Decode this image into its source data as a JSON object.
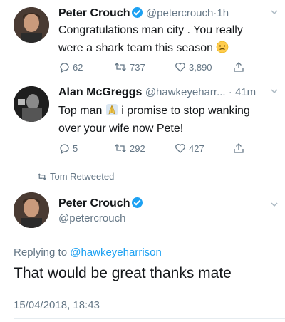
{
  "tweet1": {
    "name": "Peter Crouch",
    "handle": "@petercrouch",
    "time": "1h",
    "text_line1": "Congratulations man city . You really",
    "text_line2": "were a shark team this season",
    "emoji": "confused-face-emoji",
    "replies": "62",
    "retweets": "737",
    "likes": "3,890"
  },
  "tweet2": {
    "name": "Alan McGreggs",
    "handle": "@hawkeyeharr...",
    "time": "41m",
    "text_part1": "Top man",
    "emoji": "praying-hands-emoji",
    "text_part2": "i promise to stop wanking",
    "text_line2": "over your wife now Pete!",
    "replies": "5",
    "retweets": "292",
    "likes": "427"
  },
  "retweet_banner": {
    "label": "Tom Retweeted"
  },
  "tweet3": {
    "name": "Peter Crouch",
    "handle": "@petercrouch",
    "replying_prefix": "Replying to",
    "replying_handle": "@hawkeyeharrison",
    "text": "That would be great thanks mate",
    "timestamp": "15/04/2018, 18:43"
  },
  "colors": {
    "accent": "#1da1f2",
    "text": "#14171a",
    "muted": "#657786",
    "divider": "#e6ecf0"
  }
}
